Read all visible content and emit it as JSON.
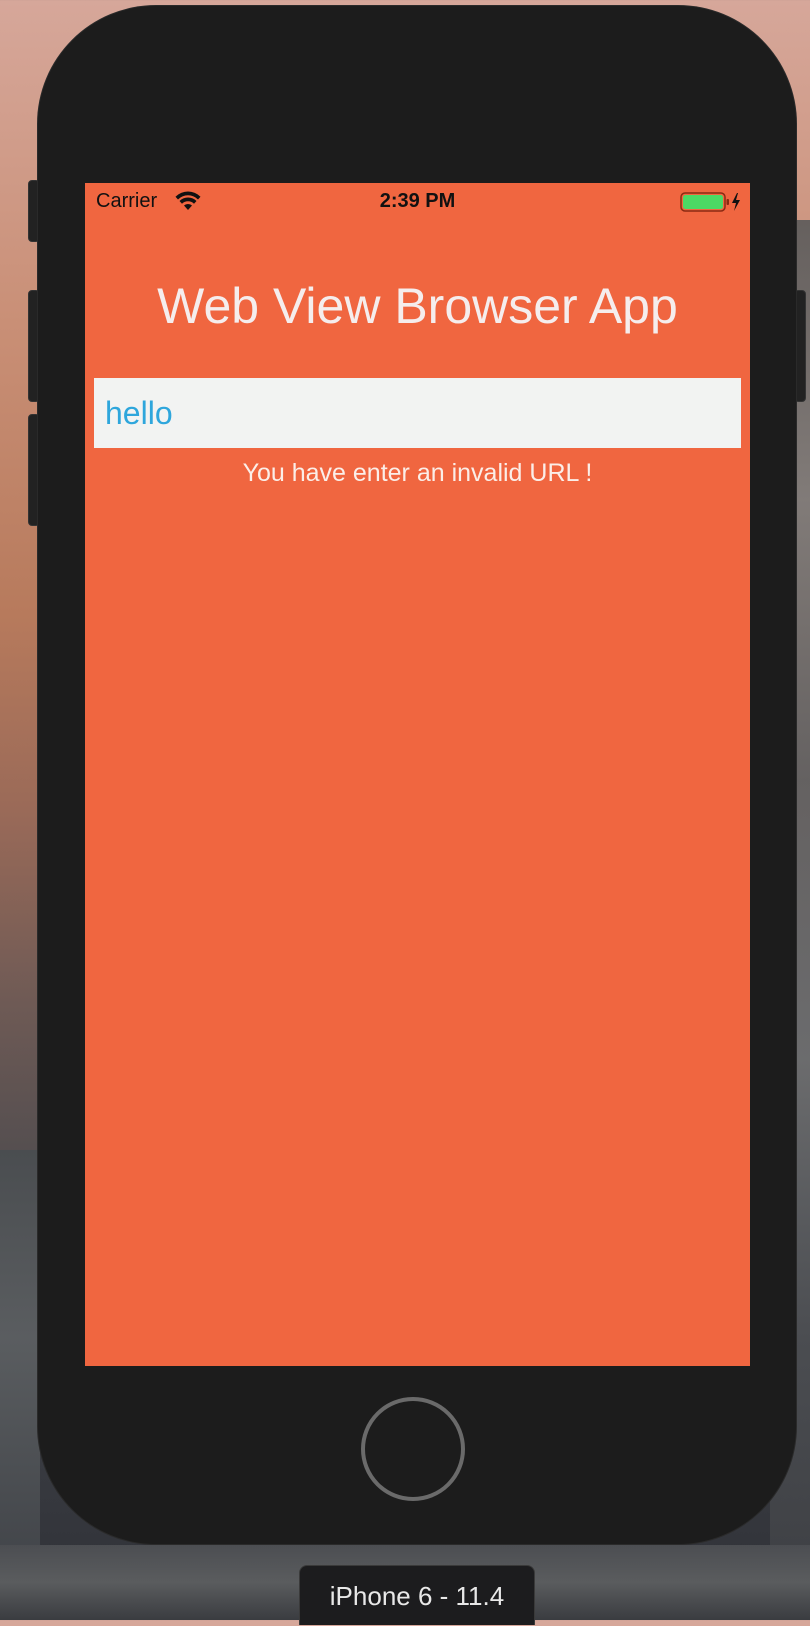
{
  "status_bar": {
    "carrier": "Carrier",
    "time": "2:39 PM",
    "wifi_icon": "wifi-icon",
    "battery_icon": "battery-charging-icon",
    "battery_color": "#4cd964"
  },
  "app": {
    "title": "Web View Browser App",
    "url_field_value": "hello",
    "error_message": "You have enter an invalid URL !",
    "background_color": "#f06640",
    "input_text_color": "#2ea6dc"
  },
  "simulator": {
    "device_label": "iPhone 6 - 11.4",
    "home_button_icon": "home-button-icon"
  }
}
